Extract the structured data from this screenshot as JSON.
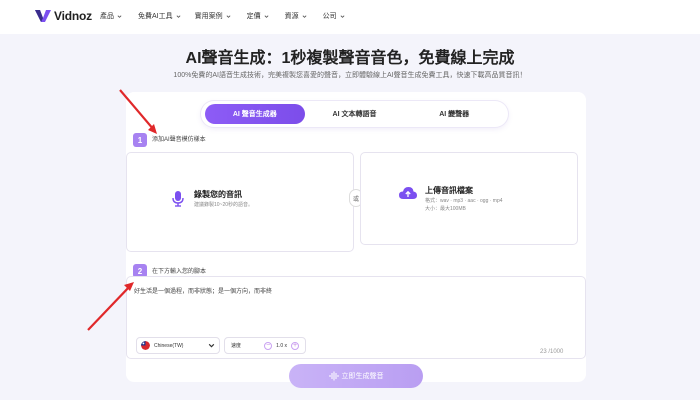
{
  "brand": {
    "name": "Vidnoz"
  },
  "nav": {
    "items": [
      {
        "label": "產品"
      },
      {
        "label": "免費AI工具"
      },
      {
        "label": "實用案例"
      },
      {
        "label": "定價"
      },
      {
        "label": "資源"
      },
      {
        "label": "公司"
      }
    ]
  },
  "hero": {
    "title": "AI聲音生成：1秒複製聲音音色，免費線上完成",
    "subtitle": "100%免費的AI語音生成技術，完美複製您喜愛的聲音，立即體驗線上AI聲音生成免費工具，快速下載高品質音訊！"
  },
  "tabs": [
    {
      "label": "AI 聲音生成器",
      "active": true
    },
    {
      "label": "AI 文本轉語音",
      "active": false
    },
    {
      "label": "AI 變聲器",
      "active": false
    }
  ],
  "step1": {
    "number": "1",
    "label": "添加AI聲音模仿樣本",
    "record": {
      "title": "錄製您的音訊",
      "hint": "建議錄製10~20秒的語音。"
    },
    "or": "或",
    "upload": {
      "title": "上傳音訊檔案",
      "formats": "格式：wav · mp3 · aac · ogg · mp4",
      "size": "大小：最大100MB"
    }
  },
  "step2": {
    "number": "2",
    "label": "在下方輸入您的腳本",
    "script_text": "好生活是一個過程，而非狀態；是一個方向，而非終",
    "language": "Chinese(TW)",
    "speed_label": "速度",
    "speed_value": "1.0 x",
    "char_count": "23 /1000"
  },
  "generate_button": {
    "label": "立即生成聲音"
  },
  "colors": {
    "accent": "#8d5cf6",
    "badge": "#a782f1",
    "arrow": "#e0282a",
    "background": "#f4f4fb"
  }
}
